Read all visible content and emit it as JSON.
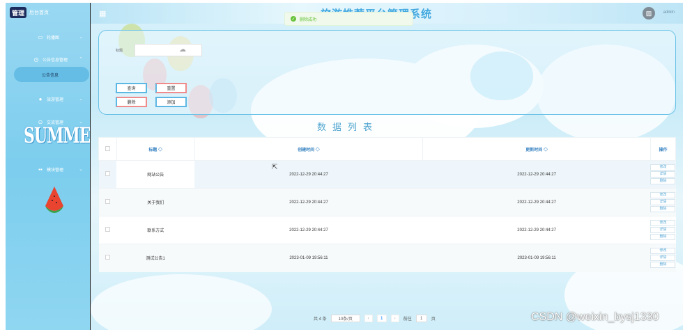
{
  "sidebar": {
    "logo_mark": "管理",
    "logo_text": "后台首页",
    "items": [
      {
        "icon": "monitor-icon",
        "label": "轮播图"
      },
      {
        "icon": "clock-icon",
        "label": "公告信息管理"
      },
      {
        "icon": "pin-icon",
        "label": "旅游管理"
      },
      {
        "icon": "compass-icon",
        "label": "交流管理"
      },
      {
        "icon": "grid-icon",
        "label": "模块管理"
      }
    ],
    "active_sub": "公告信息",
    "decor_text": "SUMMER"
  },
  "topbar": {
    "title": "旅游推荐平台管理系统",
    "user": "admin"
  },
  "toast": {
    "text": "删除成功"
  },
  "search": {
    "label": "标题",
    "placeholder": "",
    "buttons": {
      "query": "查询",
      "reset": "重置",
      "delete": "删除",
      "add": "添加"
    }
  },
  "list": {
    "title": "数据列表",
    "columns": [
      "标题 ◇",
      "创建时间 ◇",
      "更新时间 ◇",
      "操作"
    ],
    "rows": [
      {
        "title": "网站公告",
        "created": "2022-12-29 20:44:27",
        "updated": "2022-12-29 20:44:27"
      },
      {
        "title": "关于我们",
        "created": "2022-12-29 20:44:27",
        "updated": "2022-12-29 20:44:27"
      },
      {
        "title": "联系方式",
        "created": "2022-12-29 20:44:27",
        "updated": "2022-12-29 20:44:27"
      },
      {
        "title": "测试公告1",
        "created": "2023-01-09 19:56:11",
        "updated": "2023-01-09 19:56:11"
      }
    ],
    "op_labels": [
      "修改",
      "详情",
      "删除"
    ]
  },
  "pager": {
    "total": "共 4 条",
    "page_size": "10条/页",
    "current": "1",
    "goto_label": "前往",
    "goto_value": "1",
    "page_unit": "页"
  },
  "watermark": "CSDN @weixin_bysj1330",
  "colors": {
    "accent": "#41a8df",
    "sidebar": "#8fd6f1",
    "success": "#67c23a"
  }
}
